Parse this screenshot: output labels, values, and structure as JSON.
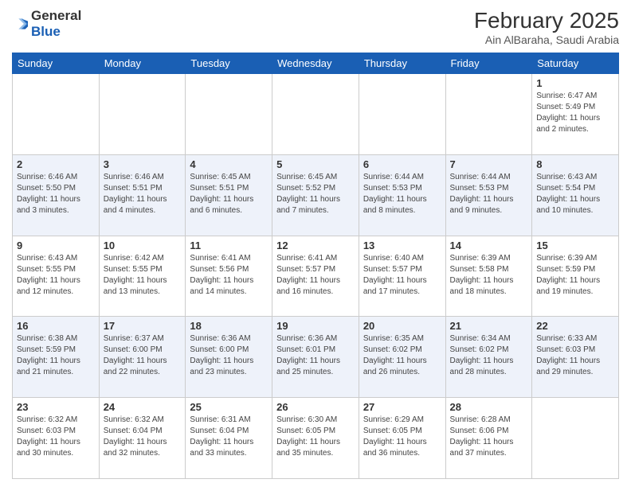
{
  "header": {
    "logo": {
      "line1": "General",
      "line2": "Blue"
    },
    "title": "February 2025",
    "subtitle": "Ain AlBaraha, Saudi Arabia"
  },
  "days_of_week": [
    "Sunday",
    "Monday",
    "Tuesday",
    "Wednesday",
    "Thursday",
    "Friday",
    "Saturday"
  ],
  "weeks": [
    [
      {
        "day": "",
        "info": ""
      },
      {
        "day": "",
        "info": ""
      },
      {
        "day": "",
        "info": ""
      },
      {
        "day": "",
        "info": ""
      },
      {
        "day": "",
        "info": ""
      },
      {
        "day": "",
        "info": ""
      },
      {
        "day": "1",
        "info": "Sunrise: 6:47 AM\nSunset: 5:49 PM\nDaylight: 11 hours and 2 minutes."
      }
    ],
    [
      {
        "day": "2",
        "info": "Sunrise: 6:46 AM\nSunset: 5:50 PM\nDaylight: 11 hours and 3 minutes."
      },
      {
        "day": "3",
        "info": "Sunrise: 6:46 AM\nSunset: 5:51 PM\nDaylight: 11 hours and 4 minutes."
      },
      {
        "day": "4",
        "info": "Sunrise: 6:45 AM\nSunset: 5:51 PM\nDaylight: 11 hours and 6 minutes."
      },
      {
        "day": "5",
        "info": "Sunrise: 6:45 AM\nSunset: 5:52 PM\nDaylight: 11 hours and 7 minutes."
      },
      {
        "day": "6",
        "info": "Sunrise: 6:44 AM\nSunset: 5:53 PM\nDaylight: 11 hours and 8 minutes."
      },
      {
        "day": "7",
        "info": "Sunrise: 6:44 AM\nSunset: 5:53 PM\nDaylight: 11 hours and 9 minutes."
      },
      {
        "day": "8",
        "info": "Sunrise: 6:43 AM\nSunset: 5:54 PM\nDaylight: 11 hours and 10 minutes."
      }
    ],
    [
      {
        "day": "9",
        "info": "Sunrise: 6:43 AM\nSunset: 5:55 PM\nDaylight: 11 hours and 12 minutes."
      },
      {
        "day": "10",
        "info": "Sunrise: 6:42 AM\nSunset: 5:55 PM\nDaylight: 11 hours and 13 minutes."
      },
      {
        "day": "11",
        "info": "Sunrise: 6:41 AM\nSunset: 5:56 PM\nDaylight: 11 hours and 14 minutes."
      },
      {
        "day": "12",
        "info": "Sunrise: 6:41 AM\nSunset: 5:57 PM\nDaylight: 11 hours and 16 minutes."
      },
      {
        "day": "13",
        "info": "Sunrise: 6:40 AM\nSunset: 5:57 PM\nDaylight: 11 hours and 17 minutes."
      },
      {
        "day": "14",
        "info": "Sunrise: 6:39 AM\nSunset: 5:58 PM\nDaylight: 11 hours and 18 minutes."
      },
      {
        "day": "15",
        "info": "Sunrise: 6:39 AM\nSunset: 5:59 PM\nDaylight: 11 hours and 19 minutes."
      }
    ],
    [
      {
        "day": "16",
        "info": "Sunrise: 6:38 AM\nSunset: 5:59 PM\nDaylight: 11 hours and 21 minutes."
      },
      {
        "day": "17",
        "info": "Sunrise: 6:37 AM\nSunset: 6:00 PM\nDaylight: 11 hours and 22 minutes."
      },
      {
        "day": "18",
        "info": "Sunrise: 6:36 AM\nSunset: 6:00 PM\nDaylight: 11 hours and 23 minutes."
      },
      {
        "day": "19",
        "info": "Sunrise: 6:36 AM\nSunset: 6:01 PM\nDaylight: 11 hours and 25 minutes."
      },
      {
        "day": "20",
        "info": "Sunrise: 6:35 AM\nSunset: 6:02 PM\nDaylight: 11 hours and 26 minutes."
      },
      {
        "day": "21",
        "info": "Sunrise: 6:34 AM\nSunset: 6:02 PM\nDaylight: 11 hours and 28 minutes."
      },
      {
        "day": "22",
        "info": "Sunrise: 6:33 AM\nSunset: 6:03 PM\nDaylight: 11 hours and 29 minutes."
      }
    ],
    [
      {
        "day": "23",
        "info": "Sunrise: 6:32 AM\nSunset: 6:03 PM\nDaylight: 11 hours and 30 minutes."
      },
      {
        "day": "24",
        "info": "Sunrise: 6:32 AM\nSunset: 6:04 PM\nDaylight: 11 hours and 32 minutes."
      },
      {
        "day": "25",
        "info": "Sunrise: 6:31 AM\nSunset: 6:04 PM\nDaylight: 11 hours and 33 minutes."
      },
      {
        "day": "26",
        "info": "Sunrise: 6:30 AM\nSunset: 6:05 PM\nDaylight: 11 hours and 35 minutes."
      },
      {
        "day": "27",
        "info": "Sunrise: 6:29 AM\nSunset: 6:05 PM\nDaylight: 11 hours and 36 minutes."
      },
      {
        "day": "28",
        "info": "Sunrise: 6:28 AM\nSunset: 6:06 PM\nDaylight: 11 hours and 37 minutes."
      },
      {
        "day": "",
        "info": ""
      }
    ]
  ]
}
